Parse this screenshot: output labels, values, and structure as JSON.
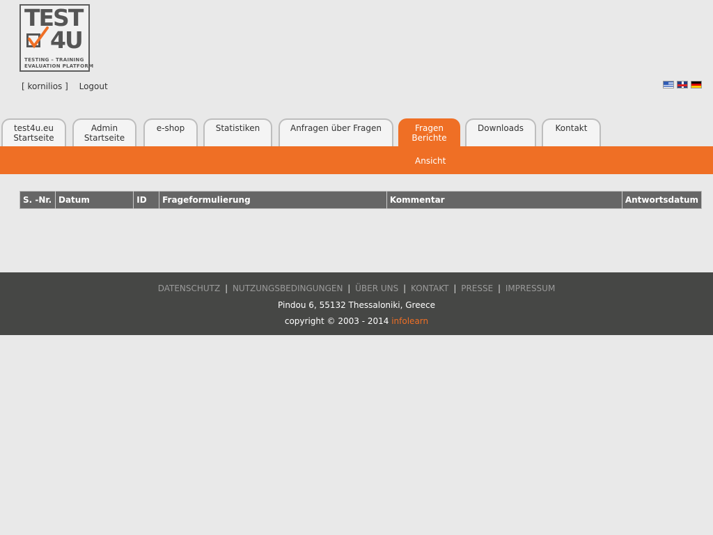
{
  "logo": {
    "line1": "TEST",
    "line2": "4U",
    "sub1": "TESTING  –  TRAINING",
    "sub2": "EVALUATION PLATFORM"
  },
  "user": {
    "username": "[ kornilios ]",
    "logout": "Logout"
  },
  "flags": [
    "greek-flag-icon",
    "uk-flag-icon",
    "german-flag-icon"
  ],
  "tabs": [
    {
      "line1": "test4u.eu",
      "line2": "Startseite"
    },
    {
      "line1": "Admin",
      "line2": "Startseite"
    },
    {
      "line1": "e-shop",
      "line2": ""
    },
    {
      "line1": "Statistiken",
      "line2": ""
    },
    {
      "line1": "Anfragen über Fragen",
      "line2": ""
    },
    {
      "line1": "Fragen",
      "line2": "Berichte"
    },
    {
      "line1": "Downloads",
      "line2": ""
    },
    {
      "line1": "Kontakt",
      "line2": ""
    }
  ],
  "active_tab": 5,
  "subnav": {
    "item": "Ansicht"
  },
  "table": {
    "columns": [
      "S. -Nr.",
      "Datum",
      "ID",
      "Frageformulierung",
      "Kommentar",
      "Antwortsdatum"
    ]
  },
  "footer": {
    "links": [
      "DATENSCHUTZ",
      "NUTZUNGSBEDINGUNGEN",
      "ÜBER UNS",
      "KONTAKT",
      "PRESSE",
      "IMPRESSUM"
    ],
    "separator": "|",
    "address": "Pindou 6, 55132 Thessaloniki, Greece",
    "copyright": "copyright © 2003 - 2014",
    "company": "infolearn"
  },
  "colors": {
    "accent": "#ef6f25",
    "footer_bg": "#464745",
    "header_bg": "#666666"
  }
}
